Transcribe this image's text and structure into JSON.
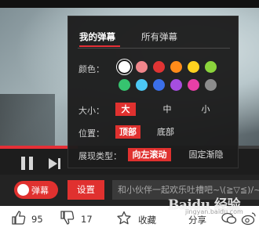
{
  "player": {
    "progress_fraction": 0.3
  },
  "danmu_settings": {
    "tabs": [
      "我的弹幕",
      "所有弹幕"
    ],
    "color": {
      "label": "颜色：",
      "swatches_row1": [
        "#ffffff",
        "#f0868b",
        "#e03434",
        "#ff8c1a",
        "#ffd21f",
        "#8bd43c"
      ],
      "swatches_row2": [
        "#36c46f",
        "#4cc8f4",
        "#3b6fe8",
        "#a64ee0",
        "#e83fa6",
        "#8c8c8c"
      ]
    },
    "size": {
      "label": "大小：",
      "options": [
        "大",
        "中",
        "小"
      ]
    },
    "position": {
      "label": "位置：",
      "options": [
        "顶部",
        "底部"
      ]
    },
    "display_type": {
      "label": "展现类型：",
      "options": [
        "向左滚动",
        "固定渐隐"
      ]
    }
  },
  "controls": {
    "toggle_label": "弹幕",
    "settings_label": "设置",
    "input_placeholder": "和小伙伴一起欢乐吐槽吧~\\(≧▽≦)/~"
  },
  "footer": {
    "like_count": "95",
    "dislike_count": "17",
    "collect_label": "收藏",
    "share_label": "分享"
  },
  "watermark": {
    "text": "Baidu 经验",
    "sub": "jingyan.baidu.com"
  },
  "colors": {
    "accent": "#e0312f",
    "panel": "#1c1c1c"
  }
}
